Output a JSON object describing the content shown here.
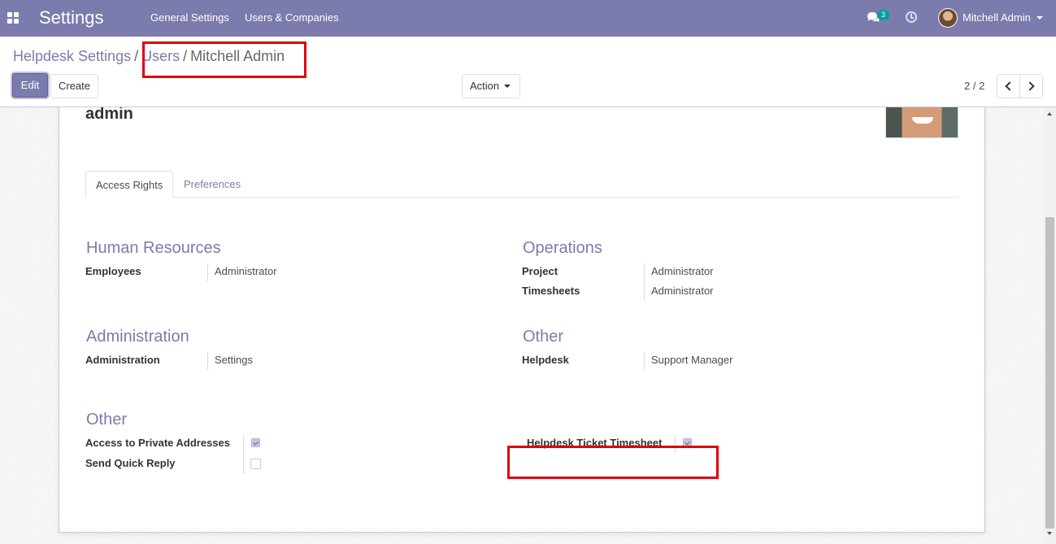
{
  "navbar": {
    "brand": "Settings",
    "menu": [
      "General Settings",
      "Users & Companies"
    ],
    "chat_count": "3",
    "user_name": "Mitchell Admin"
  },
  "breadcrumb": {
    "items": [
      "Helpdesk Settings",
      "Users"
    ],
    "current": "Mitchell Admin",
    "separator": "/"
  },
  "buttons": {
    "edit": "Edit",
    "create": "Create",
    "action": "Action"
  },
  "pager": {
    "value": "2 / 2"
  },
  "record": {
    "login": "admin"
  },
  "tabs": [
    "Access Rights",
    "Preferences"
  ],
  "sections": {
    "human_resources": {
      "title": "Human Resources",
      "fields": [
        {
          "label": "Employees",
          "value": "Administrator"
        }
      ]
    },
    "operations": {
      "title": "Operations",
      "fields": [
        {
          "label": "Project",
          "value": "Administrator"
        },
        {
          "label": "Timesheets",
          "value": "Administrator"
        }
      ]
    },
    "administration": {
      "title": "Administration",
      "fields": [
        {
          "label": "Administration",
          "value": "Settings"
        }
      ]
    },
    "other_apps": {
      "title": "Other",
      "fields": [
        {
          "label": "Helpdesk",
          "value": "Support Manager"
        }
      ]
    },
    "other": {
      "title": "Other",
      "fields": [
        {
          "label": "Access to Private Addresses",
          "checked": true
        },
        {
          "label": "Send Quick Reply",
          "checked": false
        },
        {
          "label": "Helpdesk Ticket Timesheet",
          "checked": true
        }
      ]
    }
  },
  "colors": {
    "brand": "#7c7bad",
    "highlight": "#e0000f"
  }
}
